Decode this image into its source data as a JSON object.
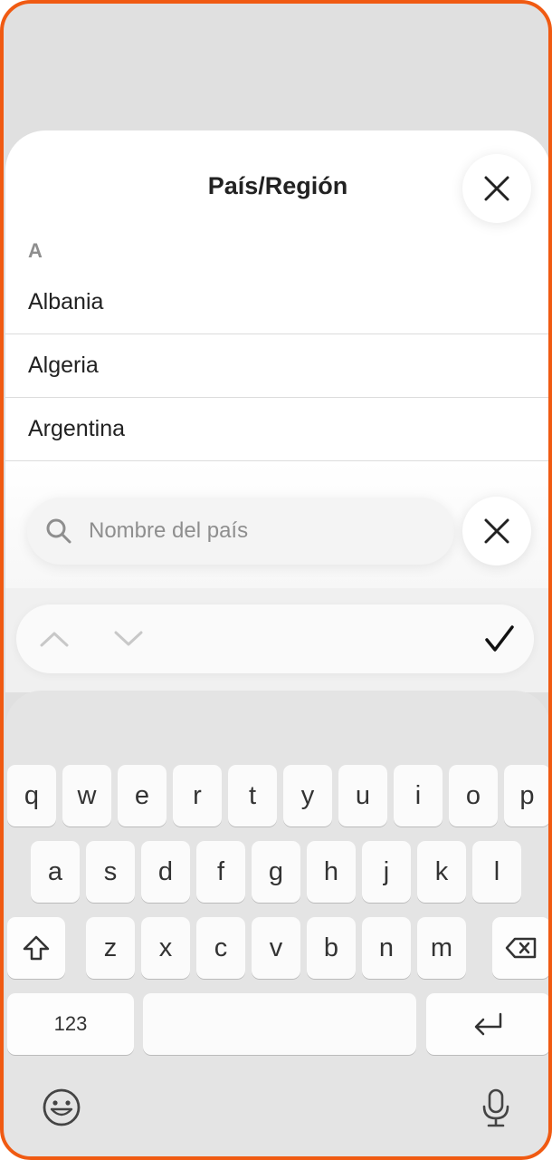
{
  "sheet": {
    "title": "País/Región",
    "section_letter": "A",
    "countries": [
      "Albania",
      "Algeria",
      "Argentina"
    ]
  },
  "search": {
    "placeholder": "Nombre del país",
    "value": ""
  },
  "keyboard": {
    "row1": [
      "q",
      "w",
      "e",
      "r",
      "t",
      "y",
      "u",
      "i",
      "o",
      "p"
    ],
    "row2": [
      "a",
      "s",
      "d",
      "f",
      "g",
      "h",
      "j",
      "k",
      "l"
    ],
    "row3": [
      "z",
      "x",
      "c",
      "v",
      "b",
      "n",
      "m"
    ],
    "numbers_label": "123",
    "space_label": ""
  },
  "icons": {
    "close": "close-icon",
    "search": "search-icon",
    "up": "chevron-up-icon",
    "down": "chevron-down-icon",
    "done": "checkmark-icon",
    "shift": "shift-icon",
    "backspace": "backspace-icon",
    "return": "return-icon",
    "emoji": "emoji-icon",
    "mic": "microphone-icon"
  },
  "colors": {
    "frame": "#f05a12",
    "text": "#222222",
    "muted": "#8e8e8e"
  }
}
